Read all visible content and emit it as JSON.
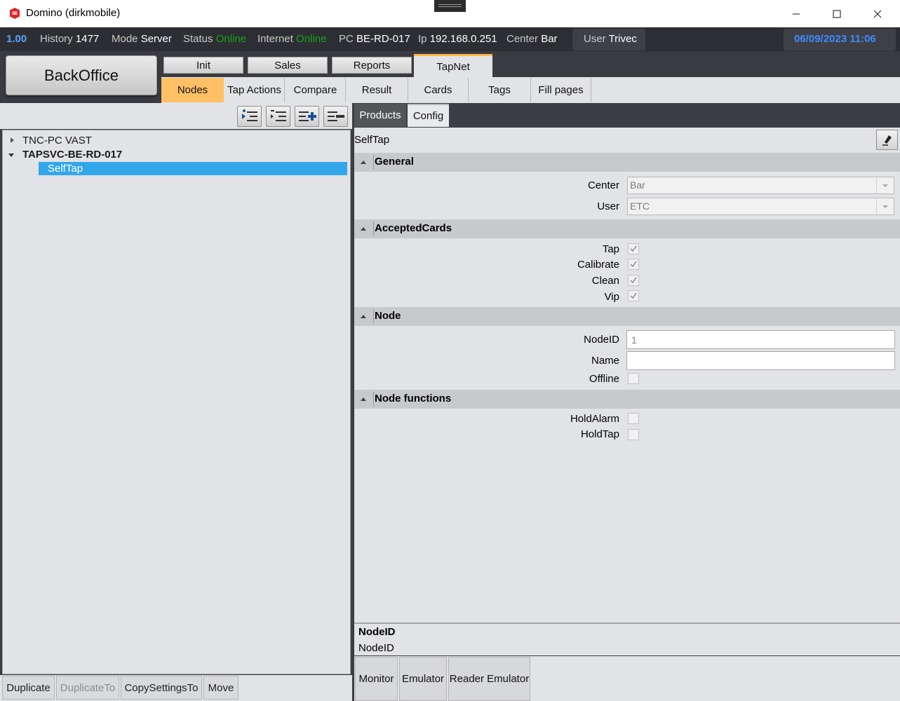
{
  "window": {
    "title": "Domino (dirkmobile)",
    "brand_color": "#e0242a"
  },
  "statusbar": {
    "version": "1.00",
    "history_label": "History",
    "history_value": "1477",
    "mode_label": "Mode",
    "mode_value": "Server",
    "status_label": "Status",
    "status_value": "Online",
    "internet_label": "Internet",
    "internet_value": "Online",
    "pc_label": "PC",
    "pc_value": "BE-RD-017",
    "ip_label": "Ip",
    "ip_value": "192.168.0.251",
    "center_label": "Center",
    "center_value": "Bar",
    "user_label": "User",
    "user_value": "Trivec",
    "datetime": "06/09/2023 11:06",
    "online_color": "#17a317",
    "accent_color": "#3e8bff"
  },
  "backoffice_label": "BackOffice",
  "main_tabs": [
    {
      "label": "Init"
    },
    {
      "label": "Sales"
    },
    {
      "label": "Reports"
    },
    {
      "label": "TapNet",
      "active": true
    }
  ],
  "sub_tabs": [
    {
      "label": "Nodes",
      "active": true
    },
    {
      "label": "Tap Actions"
    },
    {
      "label": "Compare"
    },
    {
      "label": "Result"
    },
    {
      "label": "Cards"
    },
    {
      "label": "Tags"
    },
    {
      "label": "Fill pages"
    }
  ],
  "tree": {
    "toolbar_icons": [
      "expand-all-icon",
      "collapse-all-icon",
      "add-node-icon",
      "remove-node-icon"
    ],
    "nodes": [
      {
        "label": "TNC-PC VAST",
        "expanded": false
      },
      {
        "label": "TAPSVC-BE-RD-017",
        "expanded": true
      },
      {
        "label": "SelfTap",
        "selected": true
      }
    ]
  },
  "left_buttons": [
    {
      "label": "Duplicate",
      "enabled": true
    },
    {
      "label": "DuplicateTo",
      "enabled": false
    },
    {
      "label": "CopySettingsTo",
      "enabled": true
    },
    {
      "label": "Move",
      "enabled": true
    }
  ],
  "detail_tabs": [
    {
      "label": "Products"
    },
    {
      "label": "Config",
      "active": true
    }
  ],
  "config": {
    "item_title": "SelfTap",
    "general": {
      "title": "General",
      "center_label": "Center",
      "center_value": "Bar",
      "user_label": "User",
      "user_value": "ETC"
    },
    "accepted_cards": {
      "title": "AcceptedCards",
      "items": [
        {
          "label": "Tap",
          "checked": true
        },
        {
          "label": "Calibrate",
          "checked": true
        },
        {
          "label": "Clean",
          "checked": true
        },
        {
          "label": "Vip",
          "checked": true
        }
      ]
    },
    "node": {
      "title": "Node",
      "nodeid_label": "NodeID",
      "nodeid_value": "1",
      "name_label": "Name",
      "name_value": "",
      "offline_label": "Offline",
      "offline_checked": false
    },
    "node_functions": {
      "title": "Node functions",
      "holdalarm_label": "HoldAlarm",
      "holdalarm_checked": false,
      "holdtap_label": "HoldTap",
      "holdtap_checked": false
    }
  },
  "description": {
    "title": "NodeID",
    "text": "NodeID"
  },
  "right_buttons": [
    {
      "label": "Monitor"
    },
    {
      "label": "Emulator"
    },
    {
      "label": "Reader Emulator"
    }
  ]
}
